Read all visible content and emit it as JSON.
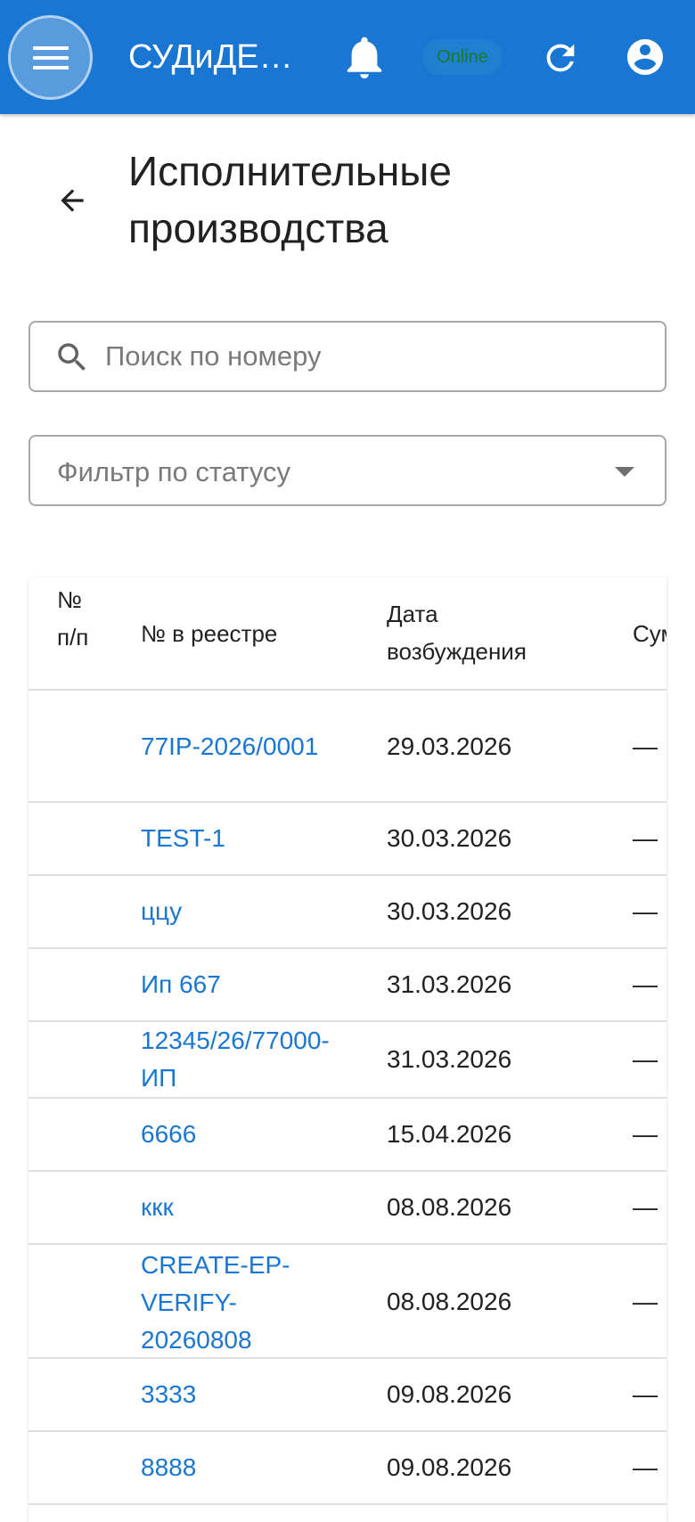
{
  "appbar": {
    "title": "СУДиДЕ…",
    "online_label": "Online",
    "icons": {
      "menu": "menu-icon",
      "notifications": "bell-icon",
      "refresh": "refresh-icon",
      "account": "account-icon"
    },
    "colors": {
      "background": "#1976d2",
      "text": "#ffffff",
      "online_text": "#1b7a2e"
    }
  },
  "page": {
    "title": "Исполнительные производства",
    "back_icon": "arrow-back-icon"
  },
  "search": {
    "placeholder": "Поиск по номеру",
    "value": ""
  },
  "filter": {
    "label": "Фильтр по статусу",
    "selected": ""
  },
  "table": {
    "headers": {
      "num": "№ п/п",
      "registry": "№ в реестре",
      "date": "Дата возбуждения",
      "sum": "Сум"
    },
    "rows": [
      {
        "num": "",
        "registry": "77IP-2026/0001",
        "date": "29.03.2026",
        "sum": "—"
      },
      {
        "num": "",
        "registry": "TEST-1",
        "date": "30.03.2026",
        "sum": "—"
      },
      {
        "num": "",
        "registry": "ццу",
        "date": "30.03.2026",
        "sum": "—"
      },
      {
        "num": "",
        "registry": "Ип 667",
        "date": "31.03.2026",
        "sum": "—"
      },
      {
        "num": "",
        "registry": "12345/26/77000-ИП",
        "date": "31.03.2026",
        "sum": "—"
      },
      {
        "num": "",
        "registry": "6666",
        "date": "15.04.2026",
        "sum": "—"
      },
      {
        "num": "",
        "registry": "ккк",
        "date": "08.08.2026",
        "sum": "—"
      },
      {
        "num": "",
        "registry": "CREATE-EP-VERIFY-20260808",
        "date": "08.08.2026",
        "sum": "—"
      },
      {
        "num": "",
        "registry": "3333",
        "date": "09.08.2026",
        "sum": "—"
      },
      {
        "num": "",
        "registry": "8888",
        "date": "09.08.2026",
        "sum": "—"
      }
    ],
    "link_color": "#1976d2"
  }
}
